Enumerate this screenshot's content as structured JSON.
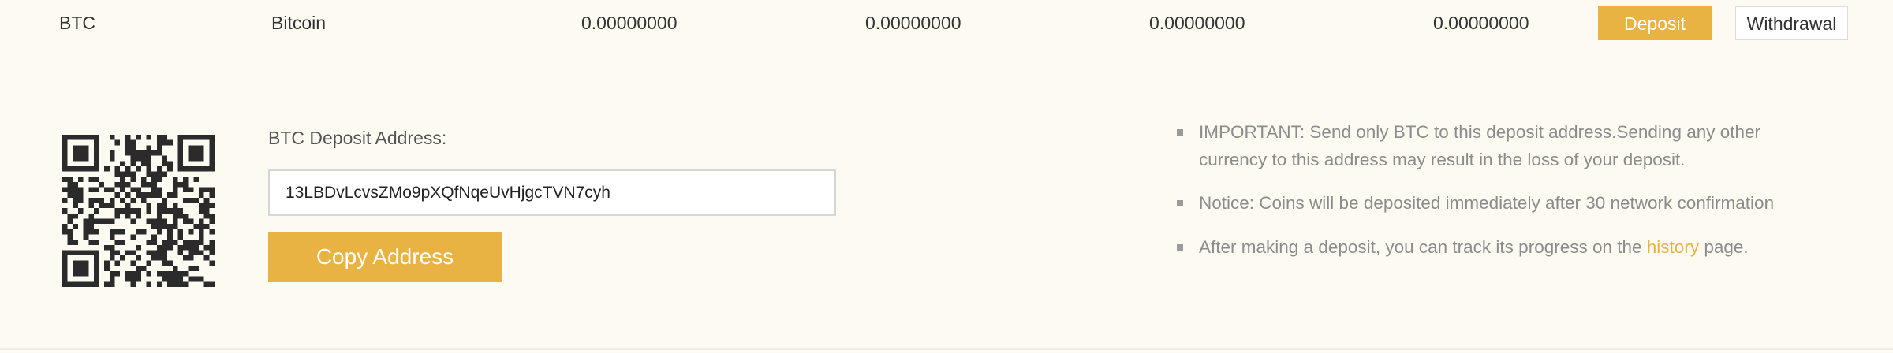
{
  "asset_row": {
    "symbol": "BTC",
    "name": "Bitcoin",
    "total": "0.00000000",
    "available": "0.00000000",
    "in_order": "0.00000000",
    "btc_value": "0.00000000",
    "deposit_label": "Deposit",
    "withdrawal_label": "Withdrawal"
  },
  "deposit": {
    "address_label": "BTC Deposit Address:",
    "address": "13LBDvLcvsZMo9pXQfNqeUvHjgcTVN7cyh",
    "copy_label": "Copy Address",
    "qr_icon": "qr-code-icon"
  },
  "notices": {
    "important": "IMPORTANT: Send only BTC to this deposit address.Sending any other currency to this address may result in the loss of your deposit.",
    "confirmation": "Notice: Coins will be deposited immediately after 30 network confirmation",
    "track_before": "After making a deposit, you can track its progress on the ",
    "track_link": "history",
    "track_after": " page."
  },
  "colors": {
    "background": "#fdfaf2",
    "accent": "#e8b342",
    "text": "#333333",
    "muted": "#8c8c8c",
    "qr": "#2b2b2b"
  }
}
